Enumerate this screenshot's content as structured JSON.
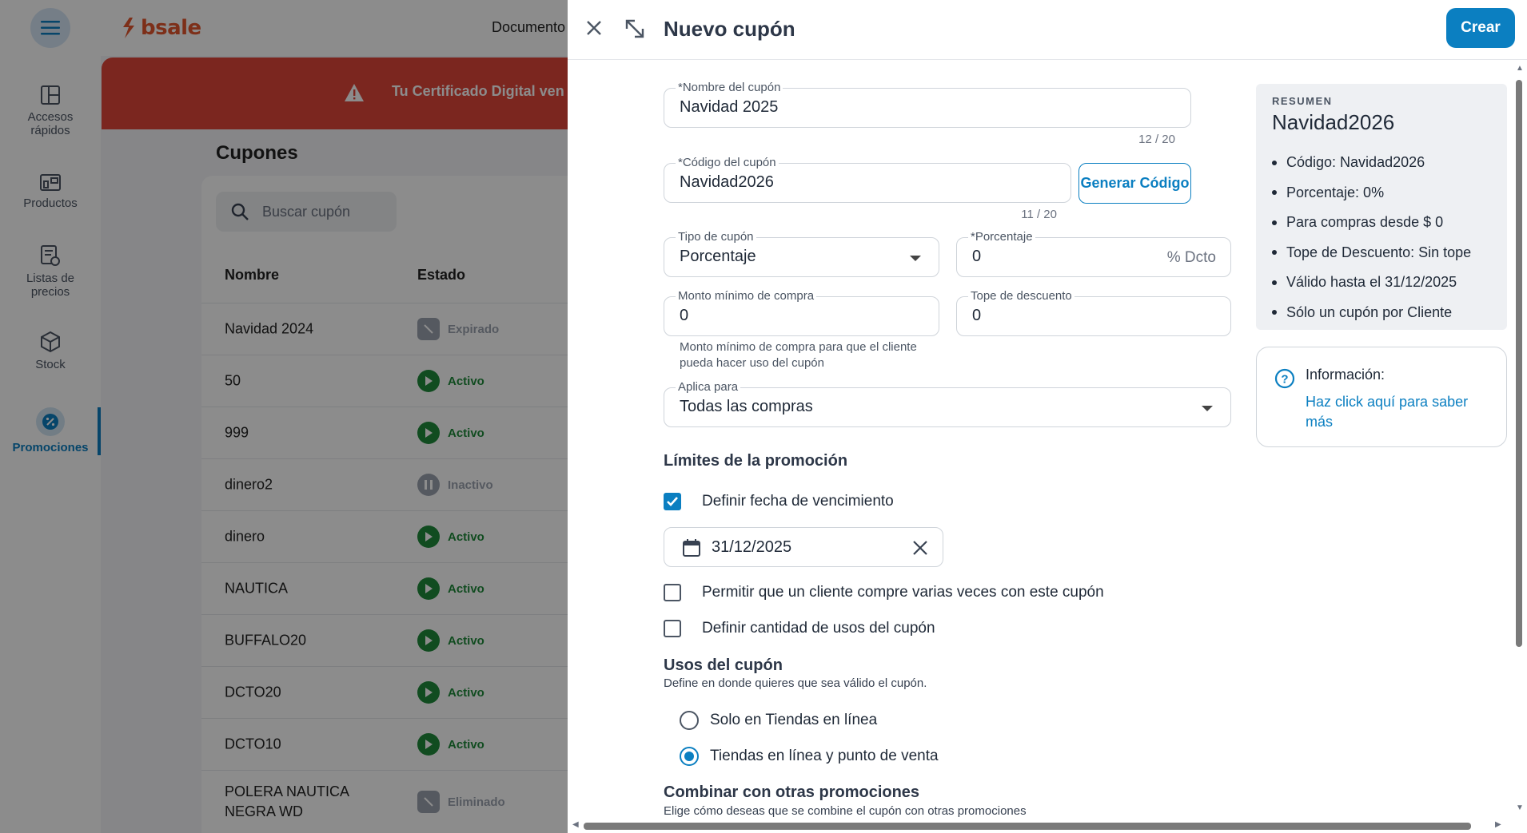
{
  "app": {
    "brand": "bsale",
    "topnav_label": "Documento",
    "banner_text": "Tu Certificado Digital ven",
    "page_title": "Cupones",
    "search_placeholder": "Buscar cupón",
    "columns": [
      "Nombre",
      "Estado"
    ],
    "sidebar": [
      {
        "label": "Accesos\nrápidos",
        "icon": "dashboard-icon"
      },
      {
        "label": "Productos",
        "icon": "products-icon"
      },
      {
        "label": "Listas de\nprecios",
        "icon": "price-list-icon"
      },
      {
        "label": "Stock",
        "icon": "box-icon"
      },
      {
        "label": "Promociones",
        "icon": "percent-icon",
        "active": true
      }
    ],
    "rows": [
      {
        "name": "Navidad 2024",
        "status": "Expirado"
      },
      {
        "name": "50",
        "status": "Activo"
      },
      {
        "name": "999",
        "status": "Activo"
      },
      {
        "name": "dinero2",
        "status": "Inactivo"
      },
      {
        "name": "dinero",
        "status": "Activo"
      },
      {
        "name": "NAUTICA",
        "status": "Activo"
      },
      {
        "name": "BUFFALO20",
        "status": "Activo"
      },
      {
        "name": "DCTO20",
        "status": "Activo"
      },
      {
        "name": "DCTO10",
        "status": "Activo"
      },
      {
        "name": "POLERA NAUTICA NEGRA WD",
        "status": "Eliminado"
      }
    ]
  },
  "drawer": {
    "title": "Nuevo cupón",
    "create_label": "Crear",
    "name_field": {
      "label": "*Nombre del cupón",
      "value": "Navidad 2025",
      "counter": "12 / 20"
    },
    "code_field": {
      "label": "*Código del cupón",
      "value": "Navidad2026",
      "counter": "11 / 20"
    },
    "generate_label": "Generar Código",
    "type_field": {
      "label": "Tipo de cupón",
      "value": "Porcentaje"
    },
    "percent_field": {
      "label": "*Porcentaje",
      "value": "0",
      "suffix": "% Dcto"
    },
    "min_field": {
      "label": "Monto mínimo de compra",
      "value": "0",
      "helper": "Monto mínimo de compra para que el cliente pueda hacer uso del cupón"
    },
    "cap_field": {
      "label": "Tope de descuento",
      "value": "0"
    },
    "applies_field": {
      "label": "Aplica para",
      "value": "Todas las compras"
    },
    "limits": {
      "title": "Límites de la promoción",
      "expiry_label": "Definir fecha de vencimiento",
      "expiry_checked": true,
      "date_value": "31/12/2025",
      "multi_label": "Permitir que un cliente compre varias veces con este cupón",
      "multi_checked": false,
      "uses_label": "Definir cantidad de usos del cupón",
      "uses_checked": false
    },
    "usage": {
      "title": "Usos del cupón",
      "subtitle": "Define en donde quieres que sea válido el cupón.",
      "options": [
        "Solo en Tiendas en línea",
        "Tiendas en línea y punto de venta"
      ],
      "selected": 1
    },
    "combine": {
      "title": "Combinar con otras promociones",
      "subtitle": "Elige cómo deseas que se combine el cupón con otras promociones"
    },
    "summary": {
      "kicker": "RESUMEN",
      "title": "Navidad2026",
      "items": [
        "Código: Navidad2026",
        "Porcentaje: 0%",
        "Para compras desde $ 0",
        "Tope de Descuento: Sin tope",
        "Válido hasta el 31/12/2025",
        "Sólo un cupón por Cliente"
      ]
    },
    "info": {
      "title": "Información:",
      "link": "Haz click aquí para saber más"
    }
  },
  "colors": {
    "accent": "#0b7fc1",
    "banner": "#e0453a",
    "active_status": "#1f8a3b",
    "inactive_status": "#9ca3af"
  }
}
